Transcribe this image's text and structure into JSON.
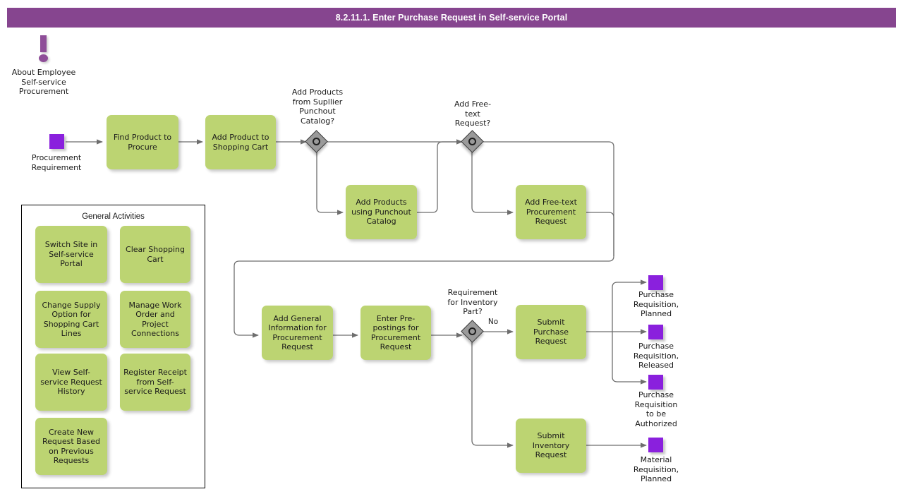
{
  "header": {
    "title": "8.2.11.1. Enter Purchase Request in Self-service Portal",
    "bar_color": "#86458f"
  },
  "theme": {
    "task_fill": "#bcd472",
    "event_fill": "#8a20dd",
    "gateway_fill": "#9a9a9a",
    "annotation_color": "#8e4e98",
    "edge_color": "#6e6e6e",
    "canvas": "#ffffff"
  },
  "annotation": {
    "icon": "exclamation-icon",
    "text": "About Employee\nSelf-service\nProcurement"
  },
  "start_event": {
    "name": "start-event",
    "label": "Procurement\nRequirement"
  },
  "tasks": [
    {
      "id": "find-product-to-procure",
      "label": "Find Product to\nProcure"
    },
    {
      "id": "add-product-to-shopping-cart",
      "label": "Add Product to\nShopping Cart"
    },
    {
      "id": "add-products-using-punchout-catalog",
      "label": "Add Products\nusing Punchout\nCatalog"
    },
    {
      "id": "add-free-text-procurement-request",
      "label": "Add Free-text\nProcurement\nRequest"
    },
    {
      "id": "add-general-information-for-procurement-request",
      "label": "Add General\nInformation for\nProcurement\nRequest"
    },
    {
      "id": "enter-pre-postings-for-procurement-request",
      "label": "Enter Pre-\npostings for\nProcurement\nRequest"
    },
    {
      "id": "submit-purchase-request",
      "label": "Submit Purchase\nRequest"
    },
    {
      "id": "submit-inventory-request",
      "label": "Submit\nInventory\nRequest"
    }
  ],
  "gateways": [
    {
      "id": "gateway-punchout-catalog",
      "label": "Add Products\nfrom Supllier\nPunchout\nCatalog?"
    },
    {
      "id": "gateway-free-text-request",
      "label": "Add Free-\ntext\nRequest?"
    },
    {
      "id": "gateway-inventory-part",
      "label": "Requirement\nfor Inventory\nPart?"
    }
  ],
  "edge_labels": [
    {
      "id": "edge-label-no",
      "text": "No"
    }
  ],
  "end_events": [
    {
      "id": "end-purchase-requisition-planned",
      "label": "Purchase\nRequisition,\nPlanned"
    },
    {
      "id": "end-purchase-requisition-released",
      "label": "Purchase\nRequisition,\nReleased"
    },
    {
      "id": "end-purchase-requisition-to-be-authorized",
      "label": "Purchase\nRequisition\nto be\nAuthorized"
    },
    {
      "id": "end-material-requisition-planned",
      "label": "Material\nRequisition,\nPlanned"
    }
  ],
  "general_activities": {
    "title": "General Activities",
    "items": [
      {
        "id": "switch-site-in-self-service-portal",
        "label": "Switch Site in\nSelf-service\nPortal"
      },
      {
        "id": "clear-shopping-cart",
        "label": "Clear Shopping\nCart"
      },
      {
        "id": "change-supply-option-for-shopping-cart-lines",
        "label": "Change Supply\nOption for\nShopping Cart\nLines"
      },
      {
        "id": "manage-work-order-and-project-connections",
        "label": "Manage Work\nOrder and\nProject\nConnections"
      },
      {
        "id": "view-self-service-request-history",
        "label": "View Self-\nservice Request\nHistory"
      },
      {
        "id": "register-receipt-from-self-service-request",
        "label": "Register Receipt\nfrom Self-\nservice Request"
      },
      {
        "id": "create-new-request-based-on-previous-requests",
        "label": "Create New\nRequest Based\non Previous\nRequests"
      }
    ]
  }
}
